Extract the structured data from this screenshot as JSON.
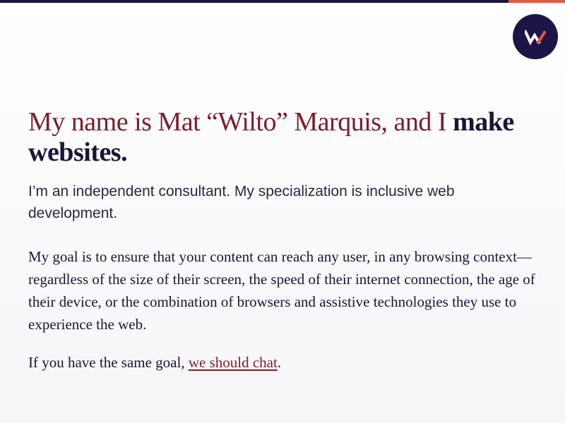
{
  "colors": {
    "navy": "#1b1240",
    "accent_orange": "#e8553e",
    "heading_red": "#7a1e2a",
    "text_dark": "#1b1535",
    "logo_bg": "#1e1547"
  },
  "header": {
    "logo_icon": "w-monogram-icon"
  },
  "hero": {
    "headline_part1": "My name is Mat “Wilto” Marquis, and I",
    "headline_part2": "make websites.",
    "lede": "I’m an independent consultant. My specialization is inclusive web development.",
    "body": "My goal is to ensure that your content can reach any user, in any browsing context—regardless of the size of their screen, the speed of their internet connection, the age of their device, or the combination of browsers and assistive technologies they use to experience the web.",
    "cta_prefix": "If you have the same goal,",
    "cta_link": "we should chat",
    "cta_suffix": "."
  }
}
